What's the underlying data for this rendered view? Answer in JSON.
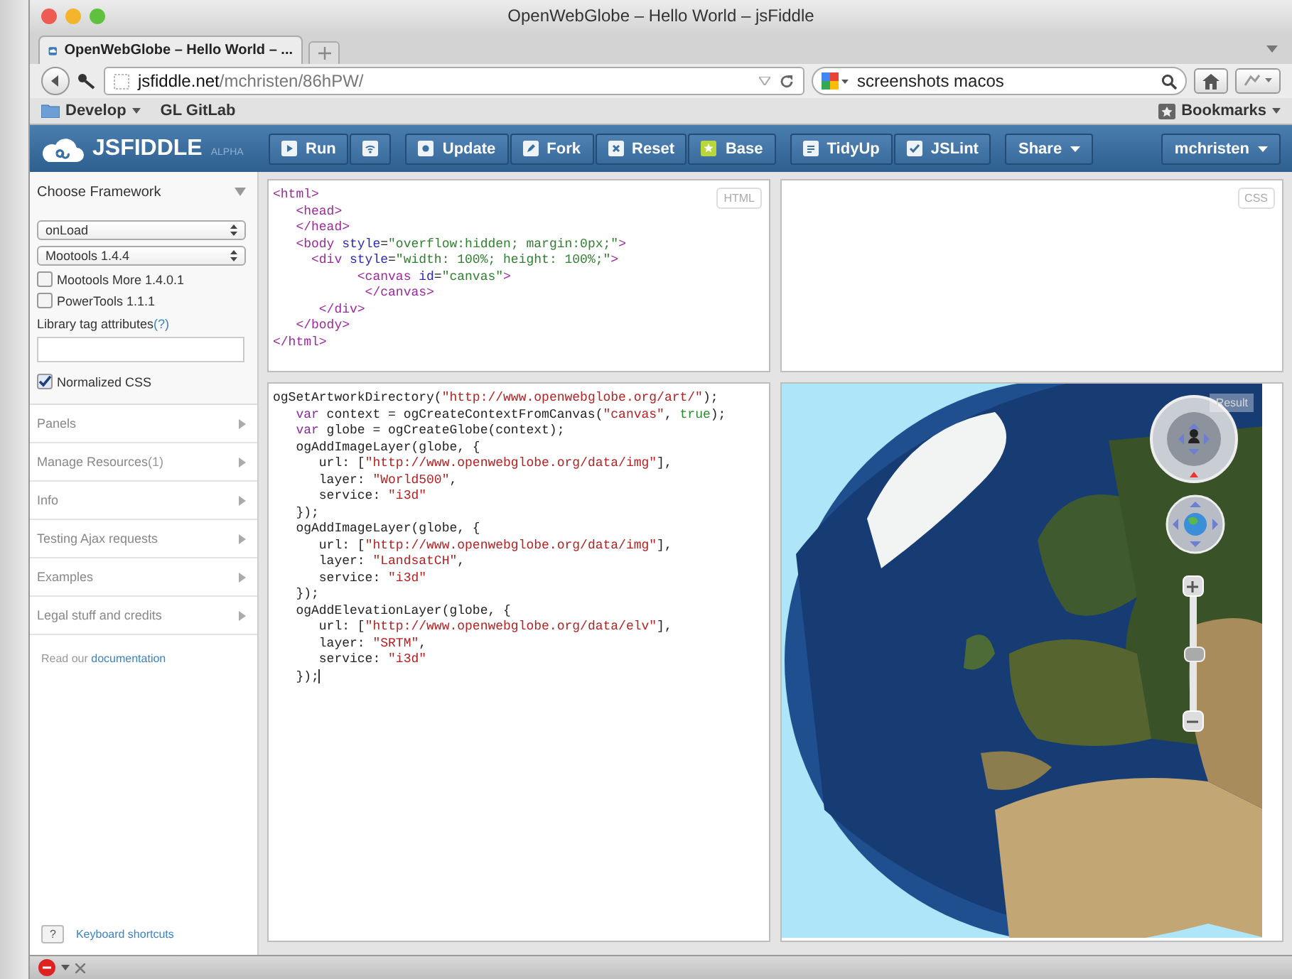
{
  "window": {
    "title": "OpenWebGlobe – Hello World – jsFiddle"
  },
  "browser_tabs": [
    {
      "label": "OpenWebGlobe – Hello World – ...",
      "selected": true
    }
  ],
  "address_bar": {
    "host": "jsfiddle.net",
    "path": "/mchristen/86hPW/"
  },
  "search": {
    "value": "screenshots macos"
  },
  "bookmarks": [
    {
      "label": "Develop",
      "kind": "folder"
    },
    {
      "label": "GL  GitLab",
      "kind": "link"
    }
  ],
  "bookmarks_menu": {
    "label": "Bookmarks"
  },
  "header": {
    "logo": "JSFIDDLE",
    "tag": "ALPHA",
    "toolbar_groups": [
      [
        "Run"
      ],
      [
        "Update",
        "Fork",
        "Reset",
        "Base"
      ],
      [
        "TidyUp",
        "JSLint"
      ]
    ],
    "share": "Share",
    "user": "mchristen"
  },
  "sidebar": {
    "title": "Choose Framework",
    "selects": [
      "onLoad",
      "Mootools 1.4.4"
    ],
    "options": [
      {
        "label": "Mootools More 1.4.0.1",
        "checked": false
      },
      {
        "label": "PowerTools 1.1.1",
        "checked": false
      }
    ],
    "tag_attributes": {
      "label": "Library tag attributes",
      "help": "(?)"
    },
    "normalized": {
      "label": "Normalized CSS",
      "checked": true
    },
    "sections": [
      {
        "label": "Panels"
      },
      {
        "label": "Manage Resources",
        "count": "(1)"
      },
      {
        "label": "Info"
      },
      {
        "label": "Testing Ajax requests"
      },
      {
        "label": "Examples"
      },
      {
        "label": "Legal stuff and credits"
      }
    ],
    "docs": {
      "text": "Read our",
      "link": "documentation"
    },
    "shortcuts": {
      "key": "?",
      "link": "Keyboard shortcuts"
    }
  },
  "panels": {
    "html_label": "HTML",
    "css_label": "CSS",
    "result_label": "Result"
  },
  "html_code": [
    [
      {
        "kind": "tag",
        "text": "<html>"
      }
    ],
    [
      {
        "kind": "tag",
        "text": "   <head>"
      }
    ],
    [
      {
        "kind": "tag",
        "text": "   </head>"
      }
    ],
    [
      {
        "kind": "tag",
        "text": "   <body"
      },
      {
        "kind": "attr",
        "text": " style"
      },
      {
        "kind": "plain",
        "text": "="
      },
      {
        "kind": "str",
        "text": "\"overflow:hidden; margin:0px;\""
      },
      {
        "kind": "tag",
        "text": ">"
      }
    ],
    [
      {
        "kind": "tag",
        "text": "     <div"
      },
      {
        "kind": "attr",
        "text": " style"
      },
      {
        "kind": "plain",
        "text": "="
      },
      {
        "kind": "str",
        "text": "\"width: 100%; height: 100%;\""
      },
      {
        "kind": "tag",
        "text": ">"
      }
    ],
    [
      {
        "kind": "tag",
        "text": "           <canvas"
      },
      {
        "kind": "attr",
        "text": " id"
      },
      {
        "kind": "plain",
        "text": "="
      },
      {
        "kind": "str",
        "text": "\"canvas\""
      },
      {
        "kind": "tag",
        "text": ">"
      }
    ],
    [
      {
        "kind": "tag",
        "text": "            </canvas>"
      }
    ],
    [
      {
        "kind": "tag",
        "text": "      </div>"
      }
    ],
    [
      {
        "kind": "tag",
        "text": "   </body>"
      }
    ],
    [
      {
        "kind": "tag",
        "text": "</html>"
      }
    ]
  ],
  "js_code": [
    [
      {
        "kind": "plain",
        "text": "ogSetArtworkDirectory("
      },
      {
        "kind": "str",
        "text": "\"http://www.openwebglobe.org/art/\""
      },
      {
        "kind": "plain",
        "text": ");"
      }
    ],
    [
      {
        "kind": "kw",
        "text": "   var"
      },
      {
        "kind": "plain",
        "text": " context = ogCreateContextFromCanvas("
      },
      {
        "kind": "str",
        "text": "\"canvas\""
      },
      {
        "kind": "plain",
        "text": ", "
      },
      {
        "kind": "atom",
        "text": "true"
      },
      {
        "kind": "plain",
        "text": ");"
      }
    ],
    [
      {
        "kind": "kw",
        "text": "   var"
      },
      {
        "kind": "plain",
        "text": " globe = ogCreateGlobe(context);"
      }
    ],
    [
      {
        "kind": "plain",
        "text": "   ogAddImageLayer(globe, {"
      }
    ],
    [
      {
        "kind": "plain",
        "text": "      url: ["
      },
      {
        "kind": "str",
        "text": "\"http://www.openwebglobe.org/data/img\""
      },
      {
        "kind": "plain",
        "text": "],"
      }
    ],
    [
      {
        "kind": "plain",
        "text": "      layer: "
      },
      {
        "kind": "str",
        "text": "\"World500\""
      },
      {
        "kind": "plain",
        "text": ","
      }
    ],
    [
      {
        "kind": "plain",
        "text": "      service: "
      },
      {
        "kind": "str",
        "text": "\"i3d\""
      }
    ],
    [
      {
        "kind": "plain",
        "text": "   });"
      }
    ],
    [
      {
        "kind": "plain",
        "text": "   ogAddImageLayer(globe, {"
      }
    ],
    [
      {
        "kind": "plain",
        "text": "      url: ["
      },
      {
        "kind": "str",
        "text": "\"http://www.openwebglobe.org/data/img\""
      },
      {
        "kind": "plain",
        "text": "],"
      }
    ],
    [
      {
        "kind": "plain",
        "text": "      layer: "
      },
      {
        "kind": "str",
        "text": "\"LandsatCH\""
      },
      {
        "kind": "plain",
        "text": ","
      }
    ],
    [
      {
        "kind": "plain",
        "text": "      service: "
      },
      {
        "kind": "str",
        "text": "\"i3d\""
      }
    ],
    [
      {
        "kind": "plain",
        "text": "   });"
      }
    ],
    [
      {
        "kind": "plain",
        "text": "   ogAddElevationLayer(globe, {"
      }
    ],
    [
      {
        "kind": "plain",
        "text": "      url: ["
      },
      {
        "kind": "str",
        "text": "\"http://www.openwebglobe.org/data/elv\""
      },
      {
        "kind": "plain",
        "text": "],"
      }
    ],
    [
      {
        "kind": "plain",
        "text": "      layer: "
      },
      {
        "kind": "str",
        "text": "\"SRTM\""
      },
      {
        "kind": "plain",
        "text": ","
      }
    ],
    [
      {
        "kind": "plain",
        "text": "      service: "
      },
      {
        "kind": "str",
        "text": "\"i3d\""
      }
    ],
    [
      {
        "kind": "plain",
        "text": "   });"
      }
    ]
  ],
  "zoom_slider": {
    "level": 0.5
  }
}
